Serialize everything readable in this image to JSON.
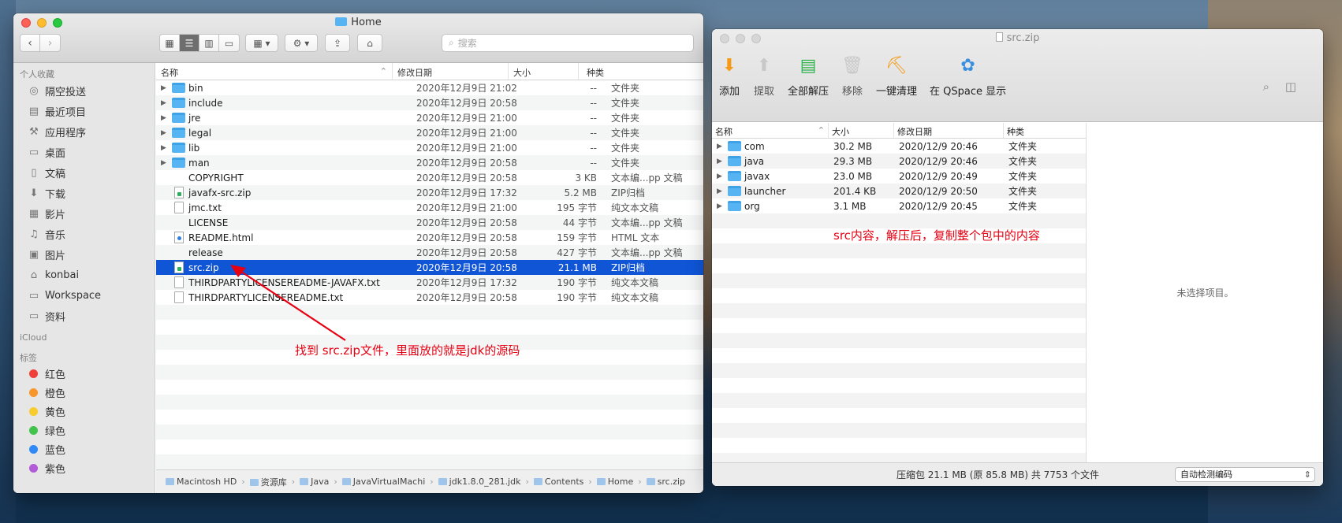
{
  "finder": {
    "title": "Home",
    "search_placeholder": "搜索",
    "sidebar": {
      "favorites_label": "个人收藏",
      "favorites": [
        {
          "label": "隔空投送",
          "icon": "airdrop-icon"
        },
        {
          "label": "最近项目",
          "icon": "recents-icon"
        },
        {
          "label": "应用程序",
          "icon": "applications-icon"
        },
        {
          "label": "桌面",
          "icon": "desktop-icon"
        },
        {
          "label": "文稿",
          "icon": "documents-icon"
        },
        {
          "label": "下载",
          "icon": "downloads-icon"
        },
        {
          "label": "影片",
          "icon": "movies-icon"
        },
        {
          "label": "音乐",
          "icon": "music-icon"
        },
        {
          "label": "图片",
          "icon": "pictures-icon"
        },
        {
          "label": "konbai",
          "icon": "home-icon"
        },
        {
          "label": "Workspace",
          "icon": "folder-icon"
        },
        {
          "label": "资料",
          "icon": "folder-icon"
        }
      ],
      "icloud_label": "iCloud",
      "tags_label": "标签",
      "tags": [
        {
          "label": "红色",
          "color": "#f0403a"
        },
        {
          "label": "橙色",
          "color": "#f7962a"
        },
        {
          "label": "黄色",
          "color": "#f8cc2d"
        },
        {
          "label": "绿色",
          "color": "#42c34c"
        },
        {
          "label": "蓝色",
          "color": "#2f8af7"
        },
        {
          "label": "紫色",
          "color": "#b25ad7"
        }
      ]
    },
    "columns": {
      "name": "名称",
      "date": "修改日期",
      "size": "大小",
      "kind": "种类"
    },
    "files": [
      {
        "name": "bin",
        "date": "2020年12月9日 21:02",
        "size": "--",
        "kind": "文件夹",
        "type": "folder"
      },
      {
        "name": "include",
        "date": "2020年12月9日 20:58",
        "size": "--",
        "kind": "文件夹",
        "type": "folder"
      },
      {
        "name": "jre",
        "date": "2020年12月9日 21:00",
        "size": "--",
        "kind": "文件夹",
        "type": "folder"
      },
      {
        "name": "legal",
        "date": "2020年12月9日 21:00",
        "size": "--",
        "kind": "文件夹",
        "type": "folder"
      },
      {
        "name": "lib",
        "date": "2020年12月9日 21:00",
        "size": "--",
        "kind": "文件夹",
        "type": "folder"
      },
      {
        "name": "man",
        "date": "2020年12月9日 20:58",
        "size": "--",
        "kind": "文件夹",
        "type": "folder"
      },
      {
        "name": "COPYRIGHT",
        "date": "2020年12月9日 20:58",
        "size": "3 KB",
        "kind": "文本编...pp 文稿",
        "type": "none"
      },
      {
        "name": "javafx-src.zip",
        "date": "2020年12月9日 17:32",
        "size": "5.2 MB",
        "kind": "ZIP归档",
        "type": "zip"
      },
      {
        "name": "jmc.txt",
        "date": "2020年12月9日 21:00",
        "size": "195 字节",
        "kind": "纯文本文稿",
        "type": "doc"
      },
      {
        "name": "LICENSE",
        "date": "2020年12月9日 20:58",
        "size": "44 字节",
        "kind": "文本编...pp 文稿",
        "type": "none"
      },
      {
        "name": "README.html",
        "date": "2020年12月9日 20:58",
        "size": "159 字节",
        "kind": "HTML 文本",
        "type": "html"
      },
      {
        "name": "release",
        "date": "2020年12月9日 20:58",
        "size": "427 字节",
        "kind": "文本编...pp 文稿",
        "type": "none"
      },
      {
        "name": "src.zip",
        "date": "2020年12月9日 20:58",
        "size": "21.1 MB",
        "kind": "ZIP归档",
        "type": "zip",
        "selected": true
      },
      {
        "name": "THIRDPARTYLICENSEREADME-JAVAFX.txt",
        "date": "2020年12月9日 17:32",
        "size": "190 字节",
        "kind": "纯文本文稿",
        "type": "doc"
      },
      {
        "name": "THIRDPARTYLICENSEREADME.txt",
        "date": "2020年12月9日 20:58",
        "size": "190 字节",
        "kind": "纯文本文稿",
        "type": "doc"
      }
    ],
    "path": [
      "Macintosh HD",
      "资源库",
      "Java",
      "JavaVirtualMachi",
      "jdk1.8.0_281.jdk",
      "Contents",
      "Home",
      "src.zip"
    ],
    "annotation": "找到 src.zip文件，里面放的就是jdk的源码"
  },
  "archive": {
    "title": "src.zip",
    "tools": [
      {
        "label": "添加",
        "icon": "add-arrow-icon",
        "color": "#f59a14",
        "enabled": true
      },
      {
        "label": "提取",
        "icon": "extract-arrow-icon",
        "color": "#c8c8c8",
        "enabled": false
      },
      {
        "label": "全部解压",
        "icon": "extract-all-icon",
        "color": "#2db34a",
        "enabled": true
      },
      {
        "label": "移除",
        "icon": "trash-icon",
        "color": "#c8c8c8",
        "enabled": false
      },
      {
        "label": "一键清理",
        "icon": "broom-icon",
        "color": "#f59a14",
        "enabled": true
      },
      {
        "label": "在 QSpace 显示",
        "icon": "qspace-icon",
        "color": "#3a8fe0",
        "enabled": true
      }
    ],
    "columns": {
      "name": "名称",
      "size": "大小",
      "date": "修改日期",
      "kind": "种类"
    },
    "entries": [
      {
        "name": "com",
        "size": "30.2 MB",
        "date": "2020/12/9 20:46",
        "kind": "文件夹"
      },
      {
        "name": "java",
        "size": "29.3 MB",
        "date": "2020/12/9 20:46",
        "kind": "文件夹"
      },
      {
        "name": "javax",
        "size": "23.0 MB",
        "date": "2020/12/9 20:49",
        "kind": "文件夹"
      },
      {
        "name": "launcher",
        "size": "201.4 KB",
        "date": "2020/12/9 20:50",
        "kind": "文件夹"
      },
      {
        "name": "org",
        "size": "3.1 MB",
        "date": "2020/12/9 20:45",
        "kind": "文件夹"
      }
    ],
    "no_selection": "未选择项目。",
    "status": "压缩包 21.1 MB (原 85.8 MB) 共 7753 个文件",
    "encoding": "自动检测编码",
    "annotation": "src内容，解压后，复制整个包中的内容"
  }
}
